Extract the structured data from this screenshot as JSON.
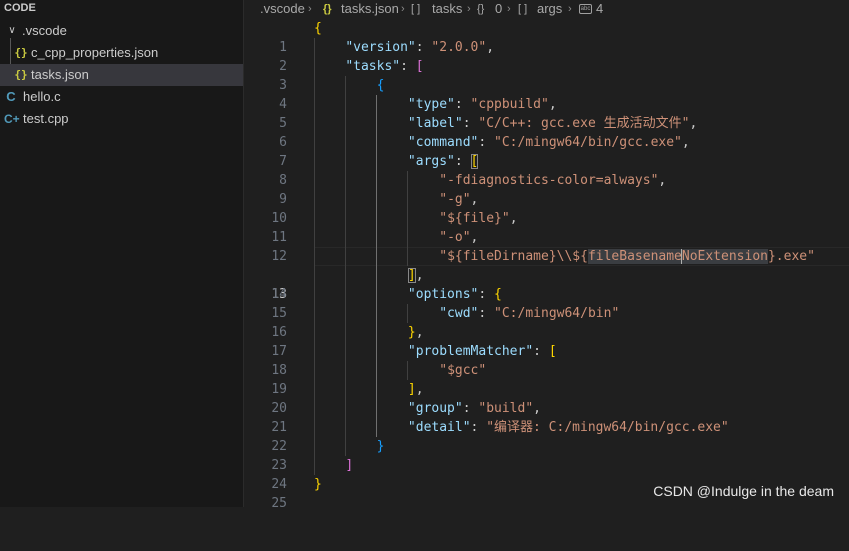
{
  "explorer": {
    "header": "CODE",
    "folder": ".vscode",
    "items": [
      {
        "label": "c_cpp_properties.json",
        "icon": "json-icon"
      },
      {
        "label": "tasks.json",
        "icon": "json-icon"
      },
      {
        "label": "hello.c",
        "icon": "c-file-icon"
      },
      {
        "label": "test.cpp",
        "icon": "cpp-file-icon"
      }
    ]
  },
  "breadcrumb": {
    "folder": ".vscode",
    "file": "tasks.json",
    "tasks": "tasks",
    "index": "0",
    "args": "args",
    "item": "4"
  },
  "icons": {
    "json": "{}",
    "c": "C",
    "cpp": "C+",
    "chevron": "›",
    "chevron_down": "∨",
    "array": "[ ]"
  },
  "code": {
    "line_numbers": [
      "1",
      "2",
      "3",
      "4",
      "5",
      "6",
      "7",
      "8",
      "9",
      "10",
      "11",
      "12",
      "13",
      "14",
      "15",
      "16",
      "17",
      "18",
      "19",
      "20",
      "21",
      "22",
      "23",
      "24",
      "25"
    ],
    "active_line": "13",
    "version": "2.0.0",
    "type": "cppbuild",
    "label": "C/C++: gcc.exe 生成活动文件",
    "command": "C:/mingw64/bin/gcc.exe",
    "args": [
      "-fdiagnostics-color=always",
      "-g",
      "${file}",
      "-o"
    ],
    "arg_last_prefix": "${fileDirname}\\\\${",
    "arg_last_word_a": "fileBasename",
    "arg_last_word_b": "NoExtension",
    "arg_last_suffix": "}.exe",
    "cwd": "C:/mingw64/bin",
    "problem_matcher": "$gcc",
    "group": "build",
    "detail": "编译器: C:/mingw64/bin/gcc.exe"
  },
  "watermark": "CSDN @Indulge in the deam",
  "colors": {
    "background": "#1f1f1f",
    "sidebar": "#181818",
    "key": "#9cdcfe",
    "string": "#ce9178",
    "bracket_gold": "#ffd700",
    "bracket_purple": "#da70d6",
    "bracket_blue": "#179fff"
  }
}
